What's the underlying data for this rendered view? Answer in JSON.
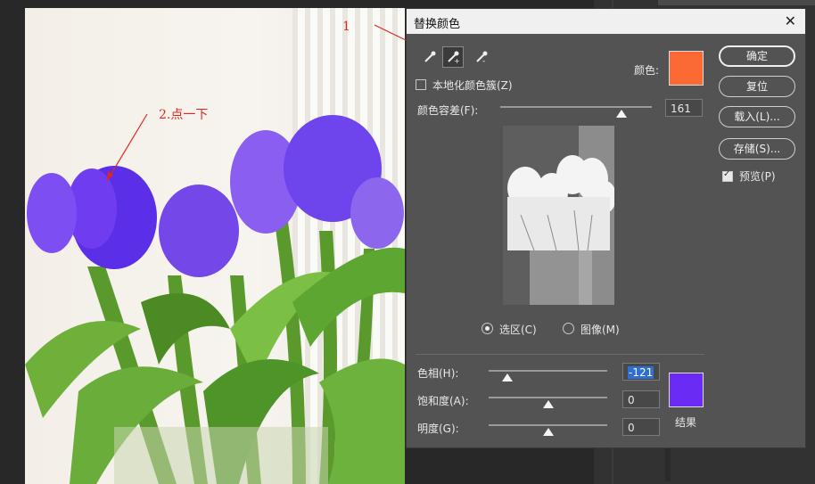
{
  "dialog": {
    "title": "替换颜色",
    "color_label": "颜色:",
    "localized_clusters": "本地化颜色簇(Z)",
    "fuzziness_label": "颜色容差(F):",
    "fuzziness_value": "161",
    "fuzziness_level": 0.81,
    "view_selection": "选区(C)",
    "view_image": "图像(M)",
    "hue_label": "色相(H):",
    "hue_value": "-121",
    "hue_level": 0.16,
    "saturation_label": "饱和度(A):",
    "saturation_value": "0",
    "saturation_level": 0.5,
    "lightness_label": "明度(G):",
    "lightness_value": "0",
    "lightness_level": 0.5,
    "result_label": "结果",
    "source_color": "#fb6a35",
    "result_color": "#6a2cf5"
  },
  "buttons": {
    "ok": "确定",
    "reset": "复位",
    "load": "载入(L)...",
    "save": "存储(S)...",
    "preview": "预览(P)"
  },
  "annotations": {
    "step1": "1",
    "step2": "2.点一下"
  }
}
